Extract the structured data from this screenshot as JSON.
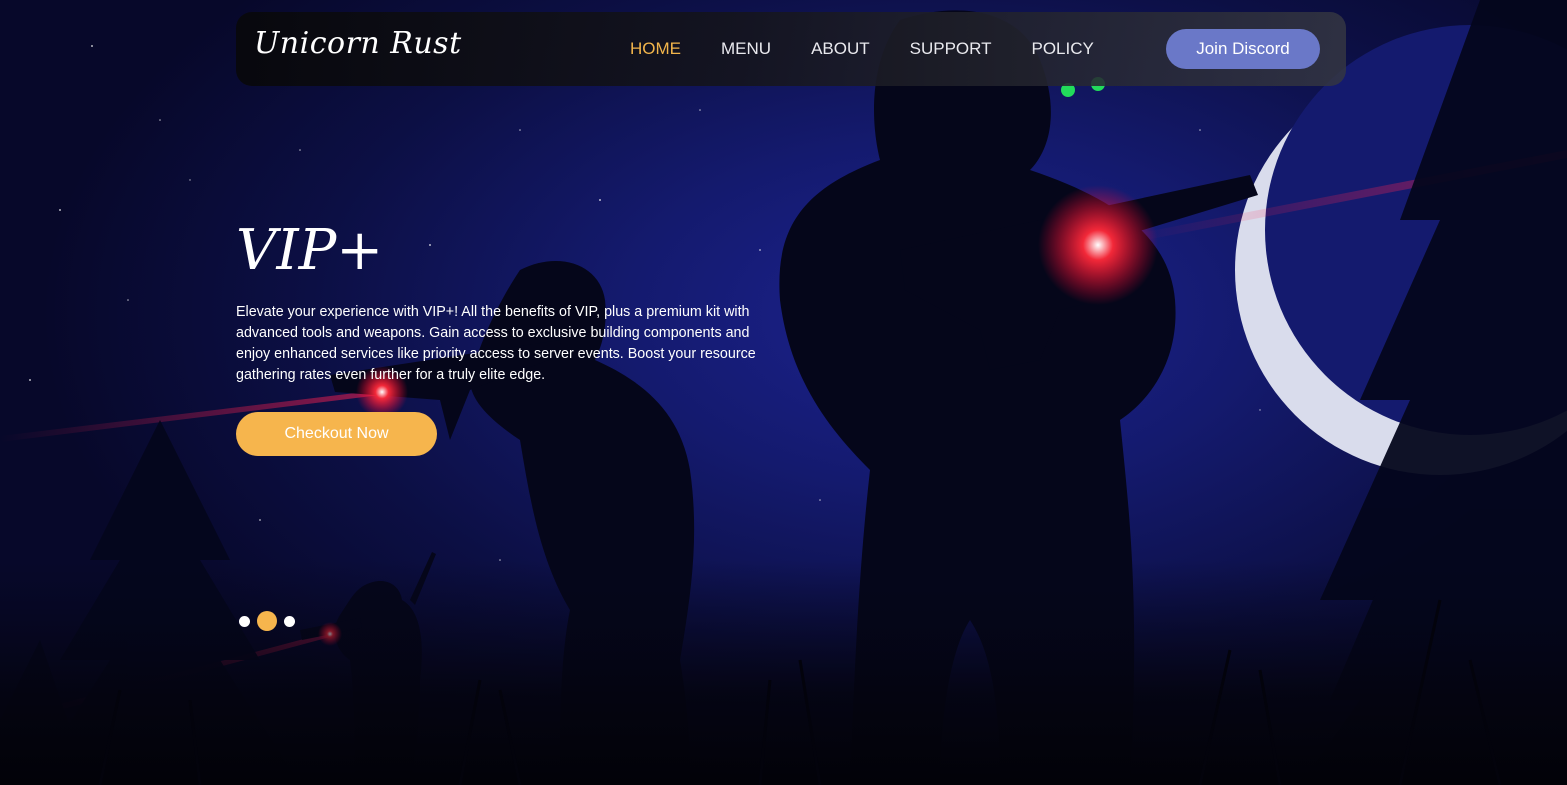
{
  "brand": {
    "logo_text": "Unicorn Rust"
  },
  "nav": {
    "links": [
      {
        "label": "HOME",
        "active": true
      },
      {
        "label": "MENU",
        "active": false
      },
      {
        "label": "ABOUT",
        "active": false
      },
      {
        "label": "SUPPORT",
        "active": false
      },
      {
        "label": "POLICY",
        "active": false
      }
    ],
    "join_label": "Join Discord"
  },
  "hero": {
    "title": "VIP+",
    "description": "Elevate your experience with VIP+! All the benefits of VIP, plus a premium kit with advanced tools and weapons. Gain access to exclusive building components and enjoy enhanced services like priority access to server events. Boost your resource gathering rates even further for a truly elite edge.",
    "cta_label": "Checkout Now"
  },
  "carousel": {
    "slides": 3,
    "active_index": 1
  },
  "colors": {
    "accent": "#f6b54d",
    "discord": "#6a78c8",
    "nav_active": "#f2b54b",
    "sky": "#141a6e"
  }
}
